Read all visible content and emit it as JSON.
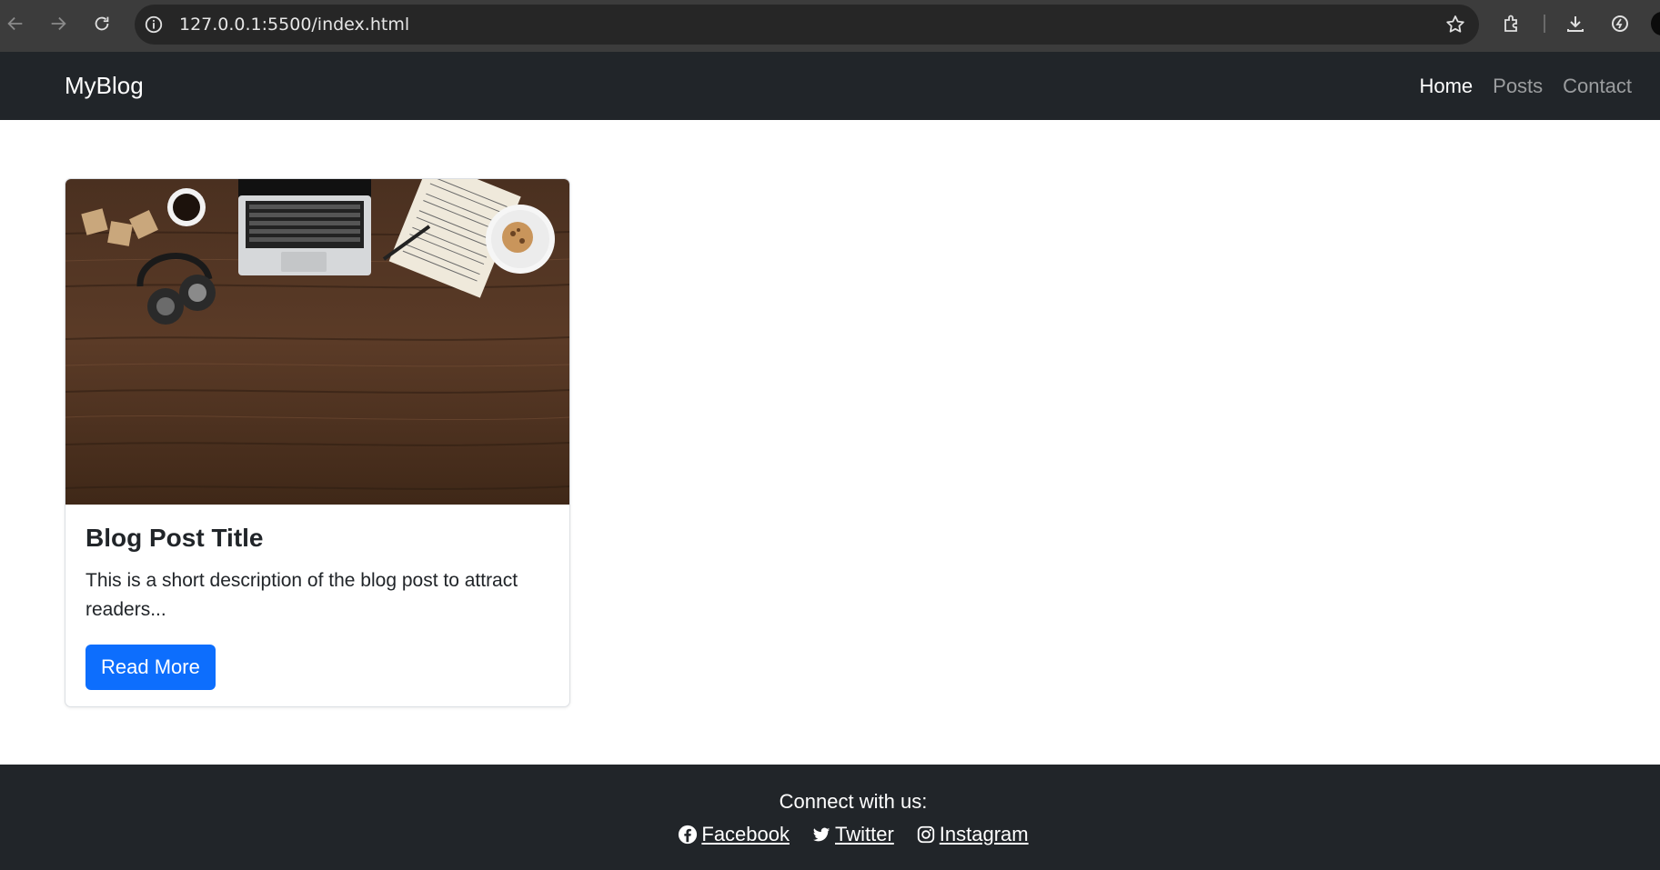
{
  "browser": {
    "url": "127.0.0.1:5500/index.html"
  },
  "navbar": {
    "brand": "MyBlog",
    "links": [
      "Home",
      "Posts",
      "Contact"
    ],
    "active": "Home"
  },
  "card": {
    "image_description_icon": "desk-photo",
    "title": "Blog Post Title",
    "text": "This is a short description of the blog post to attract readers...",
    "button_label": "Read More"
  },
  "footer": {
    "heading": "Connect with us:",
    "links": [
      {
        "label": " Facebook",
        "icon": "facebook-icon"
      },
      {
        "label": " Twitter",
        "icon": "twitter-icon"
      },
      {
        "label": " Instagram",
        "icon": "instagram-icon"
      }
    ]
  },
  "colors": {
    "navbar_bg": "#212529",
    "primary": "#0d6efd"
  }
}
